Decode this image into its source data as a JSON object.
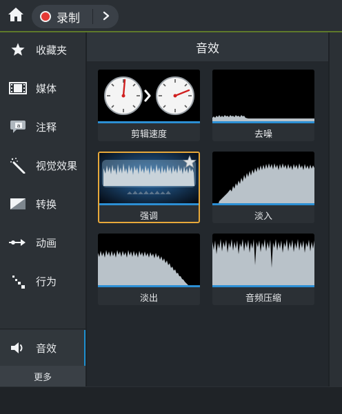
{
  "toolbar": {
    "home_icon": "home-icon",
    "record_label": "录制",
    "record_color": "#e53935",
    "expand_icon": "chevron-right-icon"
  },
  "sidebar": {
    "items": [
      {
        "label": "收藏夹",
        "icon": "star-icon"
      },
      {
        "label": "媒体",
        "icon": "film-icon"
      },
      {
        "label": "注释",
        "icon": "annotation-icon"
      },
      {
        "label": "视觉效果",
        "icon": "magic-wand-icon"
      },
      {
        "label": "转换",
        "icon": "transition-icon"
      },
      {
        "label": "动画",
        "icon": "animation-arrow-icon"
      },
      {
        "label": "行为",
        "icon": "behavior-icon"
      }
    ],
    "active_item": {
      "label": "音效",
      "icon": "speaker-icon"
    },
    "more_label": "更多"
  },
  "panel": {
    "title": "音效",
    "effects": [
      {
        "label": "剪辑速度",
        "thumb": "clip-speed"
      },
      {
        "label": "去噪",
        "thumb": "noise-removal"
      },
      {
        "label": "强调",
        "thumb": "emphasize",
        "selected": true
      },
      {
        "label": "淡入",
        "thumb": "fade-in"
      },
      {
        "label": "淡出",
        "thumb": "fade-out"
      },
      {
        "label": "音频压缩",
        "thumb": "compression"
      }
    ]
  },
  "colors": {
    "accent_blue": "#2c8fd4",
    "selection_orange": "#e8a93a",
    "top_accent_green": "#5f7a2a"
  }
}
